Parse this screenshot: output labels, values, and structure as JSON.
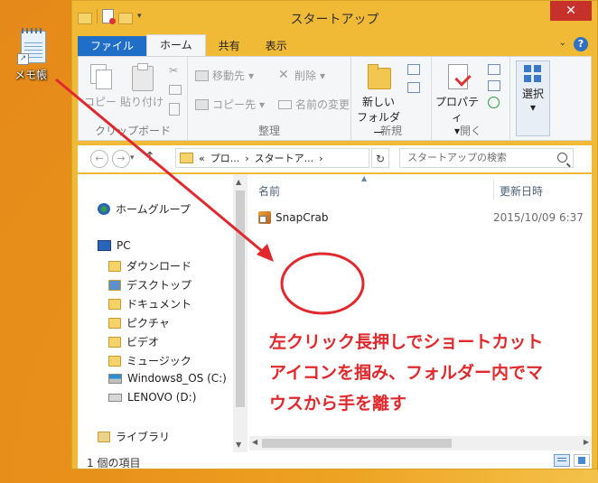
{
  "desktop": {
    "icon_label": "メモ帳"
  },
  "window": {
    "title": "スタートアップ",
    "close_glyph": "✕"
  },
  "ribbon_tabs": [
    "ファイル",
    "ホーム",
    "共有",
    "表示"
  ],
  "ribbon": {
    "clipboard": {
      "group_label": "クリップボード",
      "copy": "コピー",
      "paste": "貼り付け"
    },
    "organize": {
      "group_label": "整理",
      "move_to": "移動先",
      "copy_to": "コピー先",
      "delete": "削除",
      "rename": "名前の変更"
    },
    "new": {
      "group_label": "新規",
      "new_folder_line1": "新しい",
      "new_folder_line2": "フォルダー"
    },
    "open": {
      "group_label": "開く",
      "properties": "プロパティ"
    },
    "select": {
      "label": "選択"
    }
  },
  "navigation": {
    "back_glyph": "←",
    "forward_glyph": "→",
    "up_glyph": "↑",
    "refresh_glyph": "↻",
    "address_parts": [
      "«",
      "プロ...",
      "›",
      "スタートア...",
      "›"
    ],
    "search_placeholder": "スタートアップの検索"
  },
  "nav_pane": {
    "items": [
      {
        "label": "ホームグループ",
        "icon": "homegroup-icon"
      },
      {
        "label": "PC",
        "icon": "pc-icon"
      },
      {
        "label": "ダウンロード",
        "icon": "downloads-folder-icon"
      },
      {
        "label": "デスクトップ",
        "icon": "desktop-folder-icon"
      },
      {
        "label": "ドキュメント",
        "icon": "documents-folder-icon"
      },
      {
        "label": "ピクチャ",
        "icon": "pictures-folder-icon"
      },
      {
        "label": "ビデオ",
        "icon": "videos-folder-icon"
      },
      {
        "label": "ミュージック",
        "icon": "music-folder-icon"
      },
      {
        "label": "Windows8_OS (C:)",
        "icon": "drive-c-icon"
      },
      {
        "label": "LENOVO (D:)",
        "icon": "drive-d-icon"
      },
      {
        "label": "ライブラリ",
        "icon": "libraries-icon"
      }
    ]
  },
  "file_list": {
    "columns": [
      "名前",
      "更新日時"
    ],
    "rows": [
      {
        "name": "SnapCrab",
        "modified": "2015/10/09 6:37"
      }
    ]
  },
  "status": {
    "item_count": "1 個の項目"
  },
  "annotation": {
    "lines": [
      "左クリック長押しでショートカット",
      "アイコンを掴み、フォルダー内でマ",
      "ウスから手を離す"
    ],
    "color": "#e0282d"
  },
  "colors": {
    "titlebar": "#f0b936",
    "file_tab": "#1f6ec7",
    "close": "#c7312b",
    "desktop": "#e8901a"
  }
}
